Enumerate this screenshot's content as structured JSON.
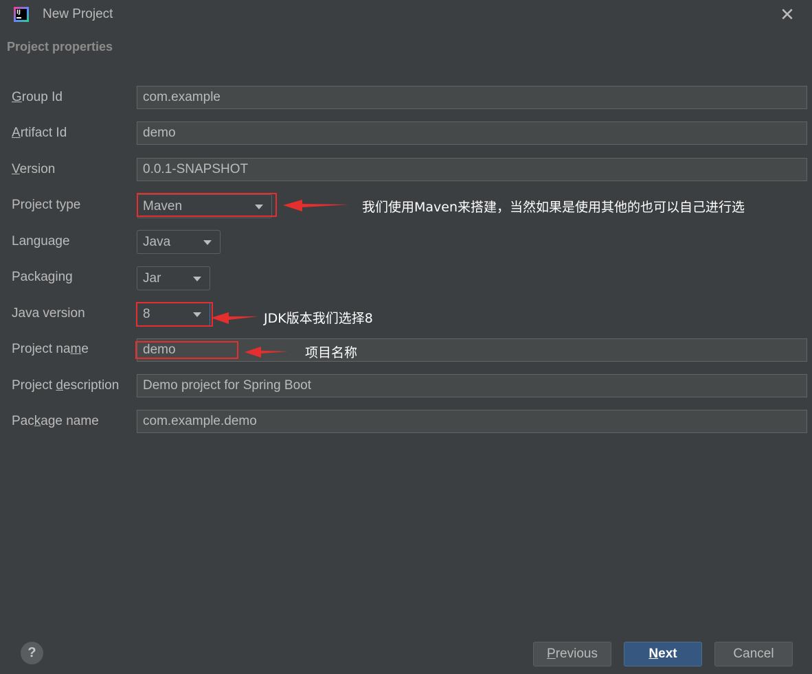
{
  "window": {
    "title": "New Project",
    "app_icon_text": "IJ"
  },
  "section_title": "Project properties",
  "fields": {
    "group_id": {
      "label_pre": "",
      "label_u": "G",
      "label_post": "roup Id",
      "value": "com.example"
    },
    "artifact_id": {
      "label_pre": "",
      "label_u": "A",
      "label_post": "rtifact Id",
      "value": "demo"
    },
    "version": {
      "label_pre": "",
      "label_u": "V",
      "label_post": "ersion",
      "value": "0.0.1-SNAPSHOT"
    },
    "project_type": {
      "label": "Project type",
      "value": "Maven"
    },
    "language": {
      "label": "Language",
      "value": "Java"
    },
    "packaging": {
      "label": "Packaging",
      "value": "Jar"
    },
    "java_version": {
      "label": "Java version",
      "value": "8"
    },
    "project_name": {
      "label_pre": "Project na",
      "label_u": "m",
      "label_post": "e",
      "value": "demo"
    },
    "project_description": {
      "label_pre": "Project ",
      "label_u": "d",
      "label_post": "escription",
      "value": "Demo project for Spring Boot"
    },
    "package_name": {
      "label_pre": "Pac",
      "label_u": "k",
      "label_post": "age name",
      "value": "com.example.demo"
    }
  },
  "annotations": {
    "project_type_note": "我们使用Maven来搭建，当然如果是使用其他的也可以自己进行选",
    "java_version_note": "JDK版本我们选择8",
    "project_name_note": "项目名称",
    "color": "#e52f2f"
  },
  "buttons": {
    "previous": {
      "u": "P",
      "rest": "revious"
    },
    "next": {
      "u": "N",
      "rest": "ext"
    },
    "cancel": "Cancel",
    "help": "?"
  }
}
